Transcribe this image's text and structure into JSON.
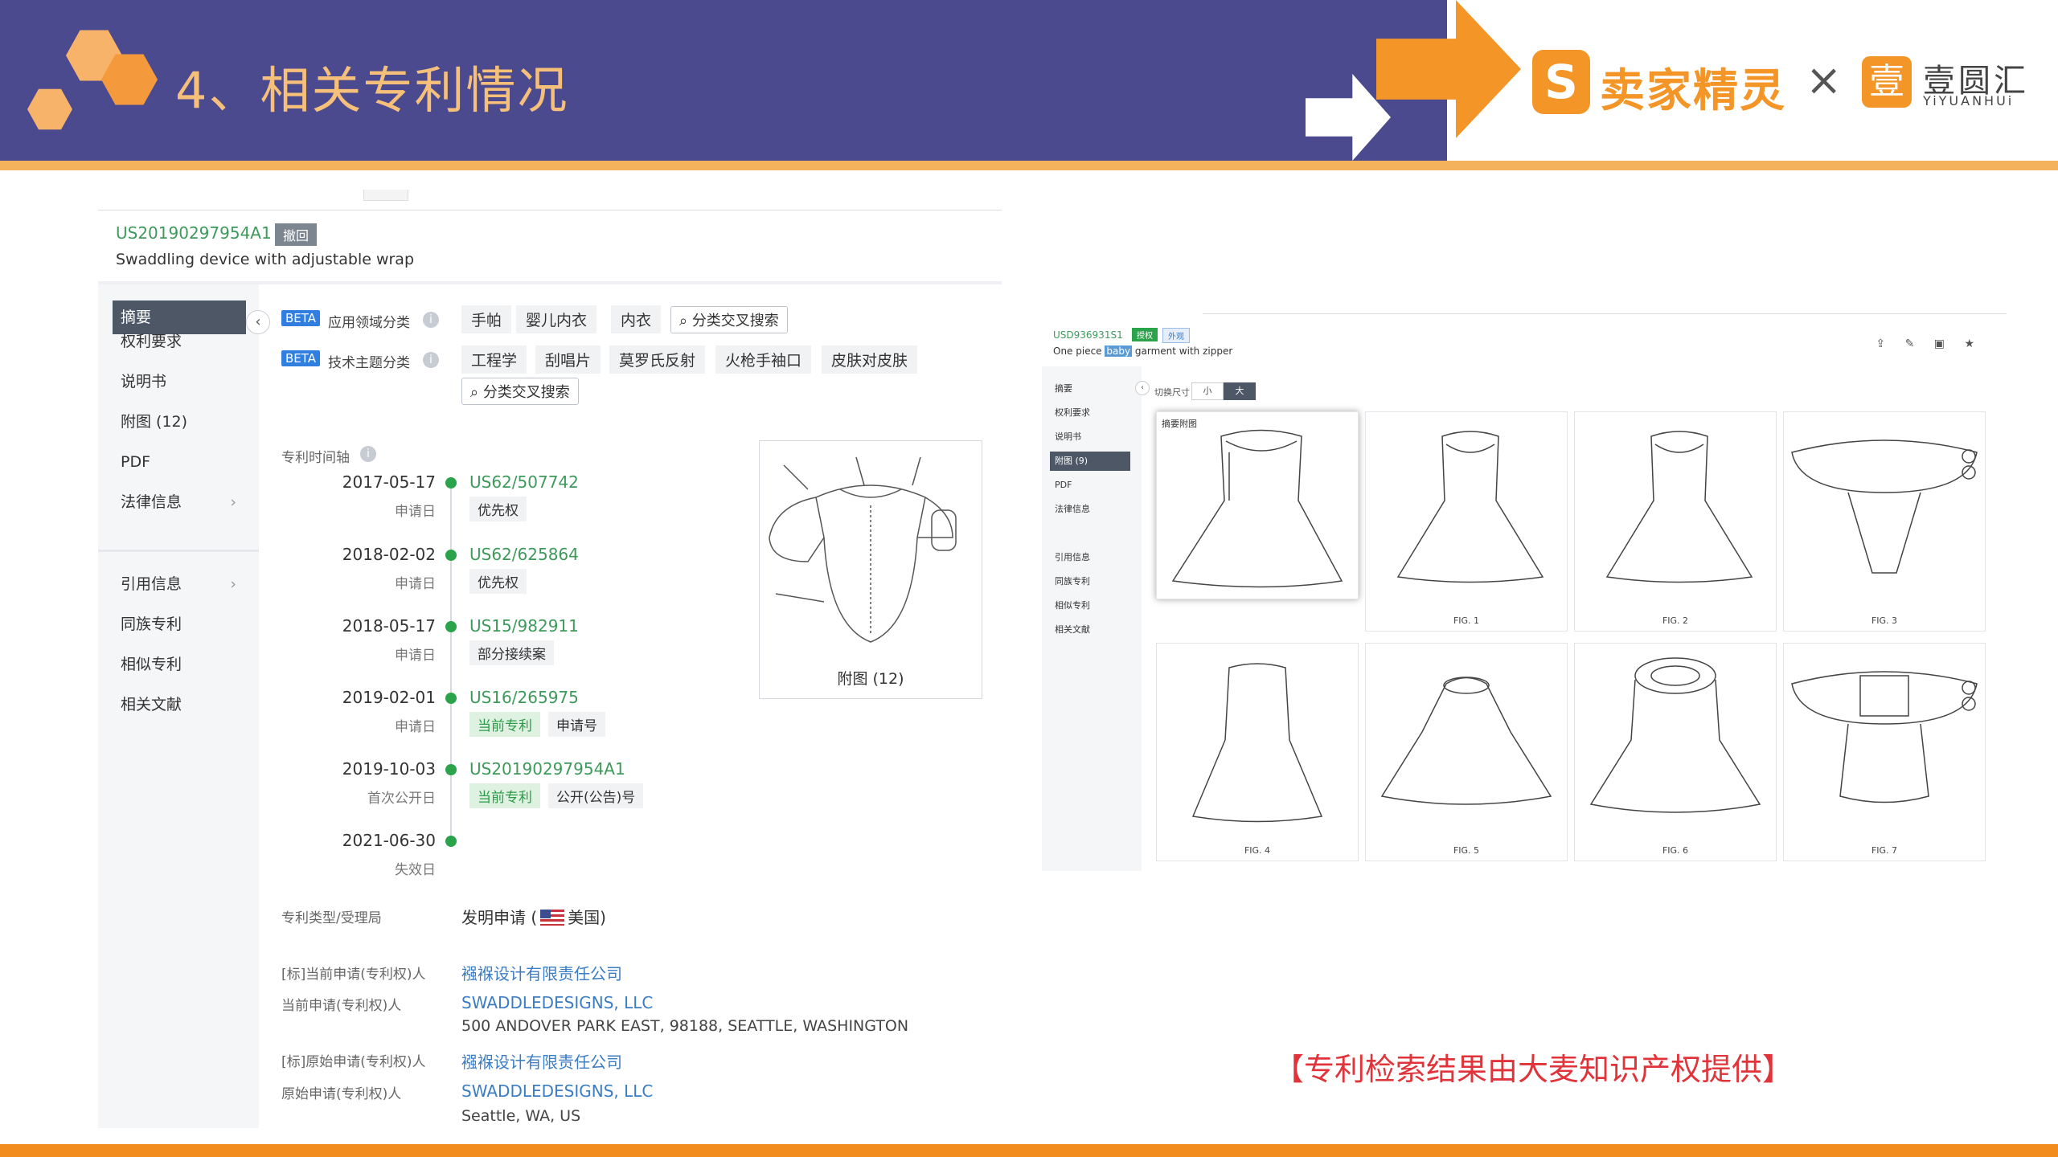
{
  "slide": {
    "title": "4、相关专利情况",
    "credit": "【专利检索结果由大麦知识产权提供】",
    "logo_brand": "卖家精灵",
    "logo_s": "S",
    "logo_times": "×",
    "logo_yi": "壹",
    "logo_partner": "壹圆汇",
    "logo_partner_en": "YiYUANHUi"
  },
  "left": {
    "patent_number": "US20190297954A1",
    "status_badge": "撤回",
    "patent_title": "Swaddling device with adjustable wrap",
    "sidebar": {
      "items": [
        "摘要",
        "权利要求",
        "说明书",
        "附图 (12)",
        "PDF",
        "法律信息",
        "引用信息",
        "同族专利",
        "相似专利",
        "相关文献"
      ],
      "chevron": "›",
      "collapse": "‹"
    },
    "classification": {
      "beta": "BETA",
      "app_label": "应用领域分类",
      "app_tags": [
        "手帕",
        "婴儿内衣",
        "内衣"
      ],
      "tech_label": "技术主题分类",
      "tech_tags": [
        "工程学",
        "刮唱片",
        "莫罗氏反射",
        "火枪手袖口",
        "皮肤对皮肤"
      ],
      "cross_search": "分类交叉搜索",
      "info": "i"
    },
    "timeline": {
      "label": "专利时间轴",
      "events": [
        {
          "date": "2017-05-17",
          "type": "申请日",
          "number": "US62/507742",
          "tags": [
            "优先权"
          ]
        },
        {
          "date": "2018-02-02",
          "type": "申请日",
          "number": "US62/625864",
          "tags": [
            "优先权"
          ]
        },
        {
          "date": "2018-05-17",
          "type": "申请日",
          "number": "US15/982911",
          "tags": [
            "部分接续案"
          ]
        },
        {
          "date": "2019-02-01",
          "type": "申请日",
          "number": "US16/265975",
          "tags": [
            "当前专利",
            "申请号"
          ]
        },
        {
          "date": "2019-10-03",
          "type": "首次公开日",
          "number": "US20190297954A1",
          "tags": [
            "当前专利",
            "公开(公告)号"
          ]
        },
        {
          "date": "2021-06-30",
          "type": "失效日",
          "number": "",
          "tags": []
        }
      ]
    },
    "figure_caption": "附图 (12)",
    "meta": {
      "type_label": "专利类型/受理局",
      "type_value": "发明申请 (",
      "country": "美国)",
      "std_current_label": "[标]当前申请(专利权)人",
      "std_current_value": "襁褓设计有限责任公司",
      "current_label": "当前申请(专利权)人",
      "current_value": "SWADDLEDESIGNS, LLC",
      "current_address": "500 ANDOVER PARK EAST, 98188, SEATTLE, WASHINGTON",
      "std_original_label": "[标]原始申请(专利权)人",
      "std_original_value": "襁褓设计有限责任公司",
      "original_label": "原始申请(专利权)人",
      "original_value": "SWADDLEDESIGNS, LLC",
      "original_address": "Seattle, WA, US"
    }
  },
  "right": {
    "patent_number": "USD936931S1",
    "badge1": "授权",
    "badge2": "外观",
    "title_prefix": "One piece ",
    "title_highlight": "baby",
    "title_suffix": " garment with zipper",
    "icons": "⇪ ✎ ▣ ★",
    "sidebar": [
      "摘要",
      "权利要求",
      "说明书",
      "附图 (9)",
      "PDF",
      "法律信息",
      "引用信息",
      "同族专利",
      "相似专利",
      "相关文献"
    ],
    "size_label": "切换尺寸",
    "size_small": "小",
    "size_big": "大",
    "abstract_fig_label": "摘要附图",
    "figures": [
      "FIG. 1",
      "FIG. 2",
      "FIG. 3",
      "FIG. 4",
      "FIG. 5",
      "FIG. 6",
      "FIG. 7"
    ]
  },
  "colors": {
    "header_purple": "#4b4a8f",
    "accent_orange": "#f39527",
    "title_orange": "#f7c07a",
    "credit_red": "#e0343a",
    "patent_green": "#3d9a5a"
  }
}
